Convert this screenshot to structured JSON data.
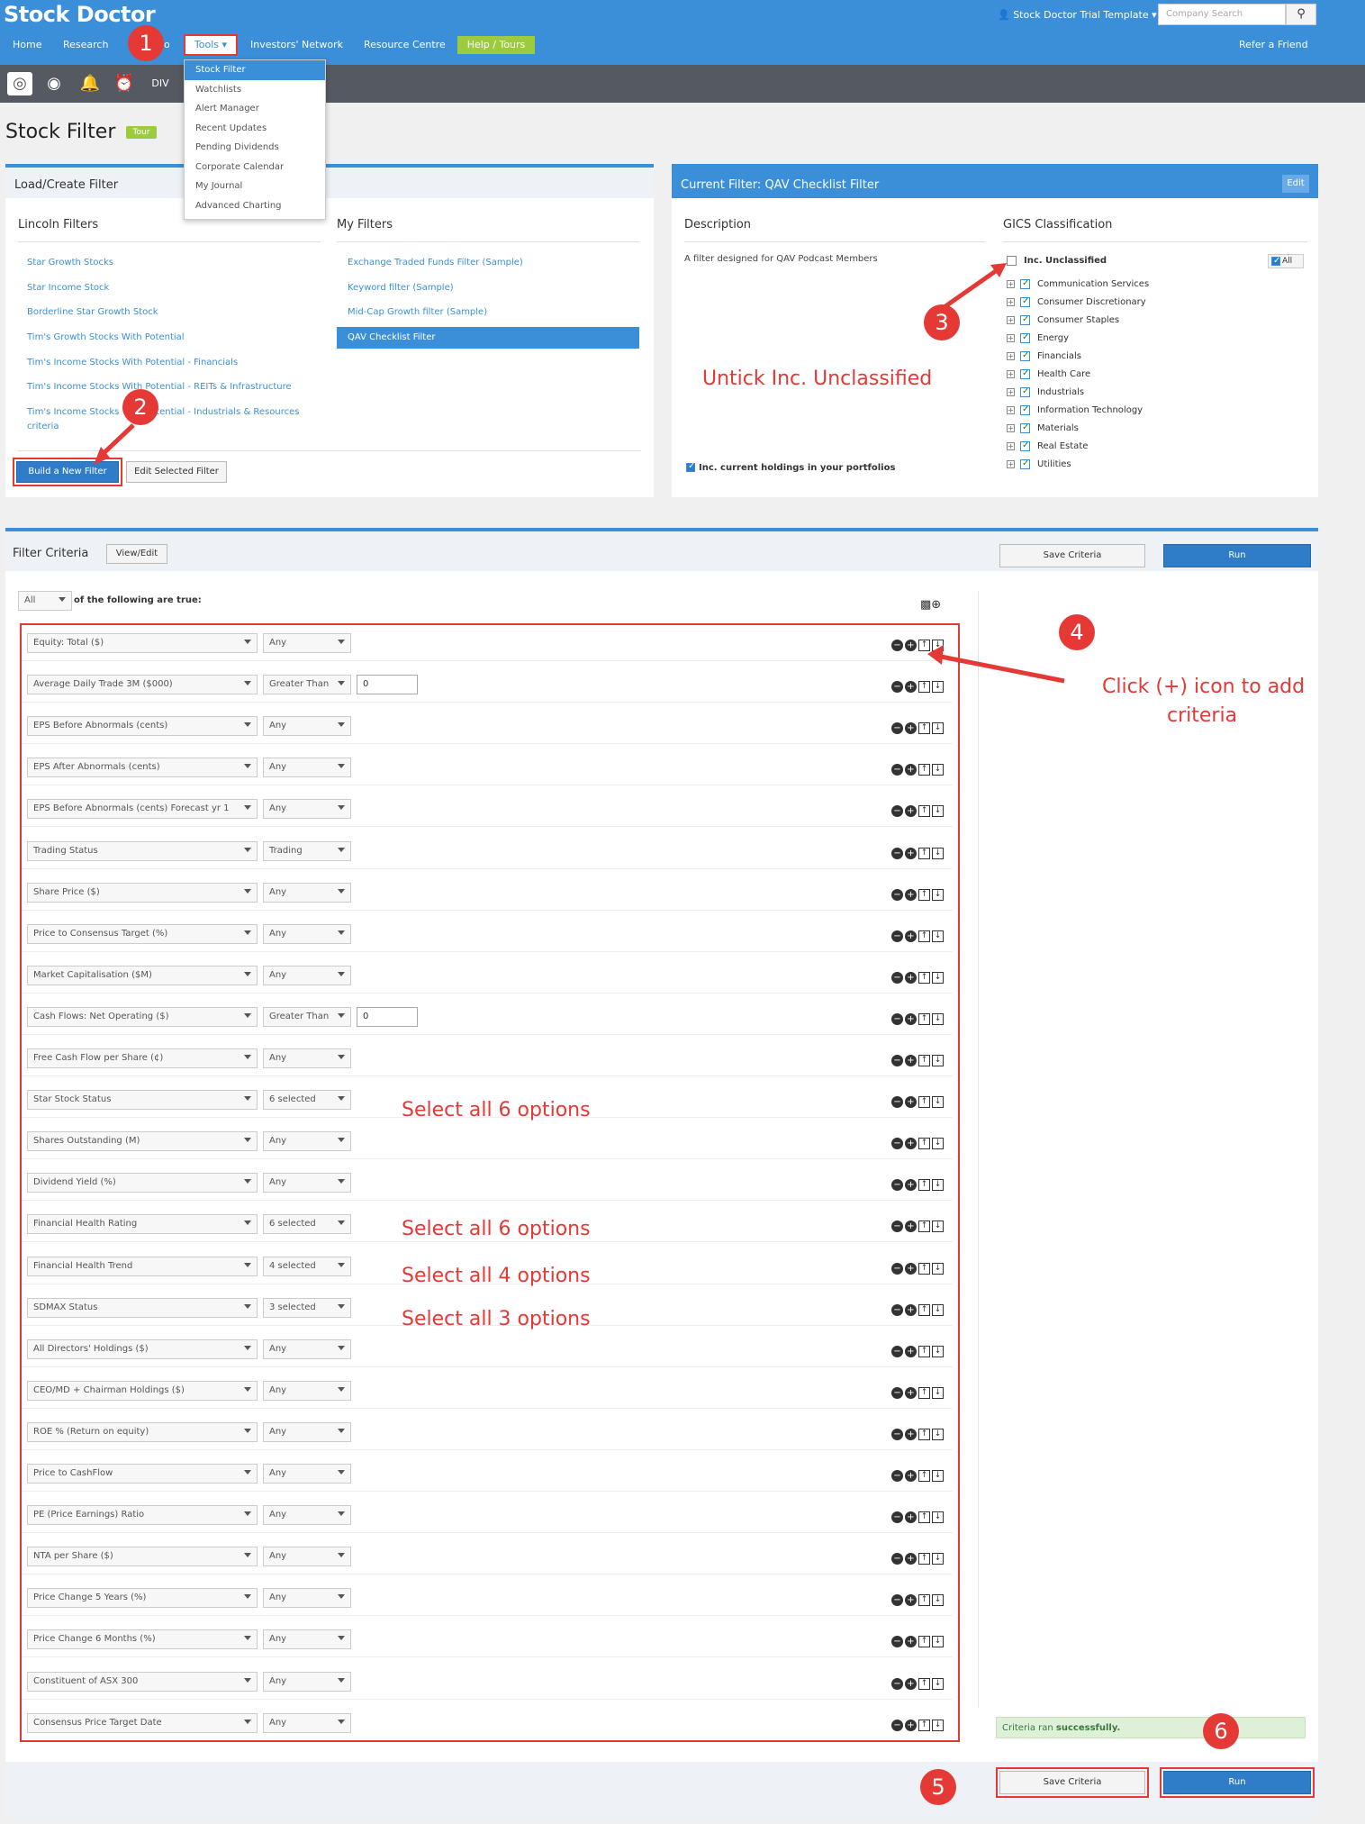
{
  "brand": "Stock Doctor",
  "user_menu": "Stock Doctor Trial Template",
  "search_placeholder": "Company Search",
  "nav": {
    "home": "Home",
    "research": "Research",
    "hidden": "o",
    "tools": "Tools",
    "investors_network": "Investors' Network",
    "resource_centre": "Resource Centre",
    "help_tours": "Help / Tours",
    "refer": "Refer a Friend"
  },
  "tools_menu": [
    "Stock Filter",
    "Watchlists",
    "Alert Manager",
    "Recent Updates",
    "Pending Dividends",
    "Corporate Calendar",
    "My Journal",
    "Advanced Charting"
  ],
  "page_title": "Stock Filter",
  "tour_label": "Tour",
  "load_panel": {
    "title": "Load/Create Filter",
    "lincoln_head": "Lincoln Filters",
    "my_head": "My Filters",
    "lincoln_filters": [
      "Star Growth Stocks",
      "Star Income Stock",
      "Borderline Star Growth Stock",
      "Tim's Growth Stocks With Potential",
      "Tim's Income Stocks With Potential - Financials",
      "Tim's Income Stocks With Potential - REITs & Infrastructure",
      "Tim's Income Stocks With Potential - Industrials & Resources",
      "criteria"
    ],
    "my_filters": [
      "Exchange Traded Funds Filter (Sample)",
      "Keyword filter (Sample)",
      "Mid-Cap Growth filter (Sample)",
      "QAV Checklist Filter"
    ],
    "build_btn": "Build a New Filter",
    "edit_btn": "Edit Selected Filter"
  },
  "current_panel": {
    "title": "Current Filter: QAV Checklist Filter",
    "edit": "Edit",
    "desc_head": "Description",
    "gics_head": "GICS Classification",
    "description": "A filter designed for QAV Podcast Members",
    "inc_unclassified": "Inc. Unclassified",
    "all_label": "All",
    "sectors": [
      "Communication Services",
      "Consumer Discretionary",
      "Consumer Staples",
      "Energy",
      "Financials",
      "Health Care",
      "Industrials",
      "Information Technology",
      "Materials",
      "Real Estate",
      "Utilities"
    ],
    "holdings": "Inc. current holdings in your portfolios"
  },
  "criteria_panel": {
    "title": "Filter Criteria",
    "view_edit": "View/Edit",
    "save": "Save Criteria",
    "run": "Run",
    "mode": "All",
    "mode_text": "of the following are true:",
    "value_zero": "0",
    "success_prefix": "Criteria ran",
    "success_bold": "successfully."
  },
  "criteria": [
    {
      "field": "Equity: Total ($)",
      "op": "Any"
    },
    {
      "field": "Average Daily Trade 3M ($000)",
      "op": "Greater Than",
      "value": "0"
    },
    {
      "field": "EPS Before Abnormals (cents)",
      "op": "Any"
    },
    {
      "field": "EPS After Abnormals (cents)",
      "op": "Any"
    },
    {
      "field": "EPS Before Abnormals (cents) Forecast yr 1",
      "op": "Any"
    },
    {
      "field": "Trading Status",
      "op": "Trading"
    },
    {
      "field": "Share Price ($)",
      "op": "Any"
    },
    {
      "field": "Price to Consensus Target (%)",
      "op": "Any"
    },
    {
      "field": "Market Capitalisation ($M)",
      "op": "Any"
    },
    {
      "field": "Cash Flows: Net Operating ($)",
      "op": "Greater Than",
      "value": "0"
    },
    {
      "field": "Free Cash Flow per Share (¢)",
      "op": "Any"
    },
    {
      "field": "Star Stock Status",
      "op": "6 selected"
    },
    {
      "field": "Shares Outstanding (M)",
      "op": "Any"
    },
    {
      "field": "Dividend Yield (%)",
      "op": "Any"
    },
    {
      "field": "Financial Health Rating",
      "op": "6 selected"
    },
    {
      "field": "Financial Health Trend",
      "op": "4 selected"
    },
    {
      "field": "SDMAX Status",
      "op": "3 selected"
    },
    {
      "field": "All Directors' Holdings ($)",
      "op": "Any"
    },
    {
      "field": "CEO/MD + Chairman Holdings ($)",
      "op": "Any"
    },
    {
      "field": "ROE % (Return on equity)",
      "op": "Any"
    },
    {
      "field": "Price to CashFlow",
      "op": "Any"
    },
    {
      "field": "PE (Price Earnings) Ratio",
      "op": "Any"
    },
    {
      "field": "NTA per Share ($)",
      "op": "Any"
    },
    {
      "field": "Price Change 5 Years (%)",
      "op": "Any"
    },
    {
      "field": "Price Change 6 Months (%)",
      "op": "Any"
    },
    {
      "field": "Constituent of ASX 300",
      "op": "Any"
    },
    {
      "field": "Consensus Price Target Date",
      "op": "Any"
    }
  ],
  "annotations": {
    "untick": "Untick Inc. Unclassified",
    "click_plus_1": "Click (+) icon to add",
    "click_plus_2": "criteria",
    "select6a": "Select all 6 options",
    "select6b": "Select all 6 options",
    "select4": "Select all 4 options",
    "select3": "Select all 3 options",
    "steps": [
      "1",
      "2",
      "3",
      "4",
      "5",
      "6"
    ]
  },
  "colors": {
    "primary": "#3a8fd8",
    "annotation": "#e53935",
    "help": "#9ccc3d"
  }
}
